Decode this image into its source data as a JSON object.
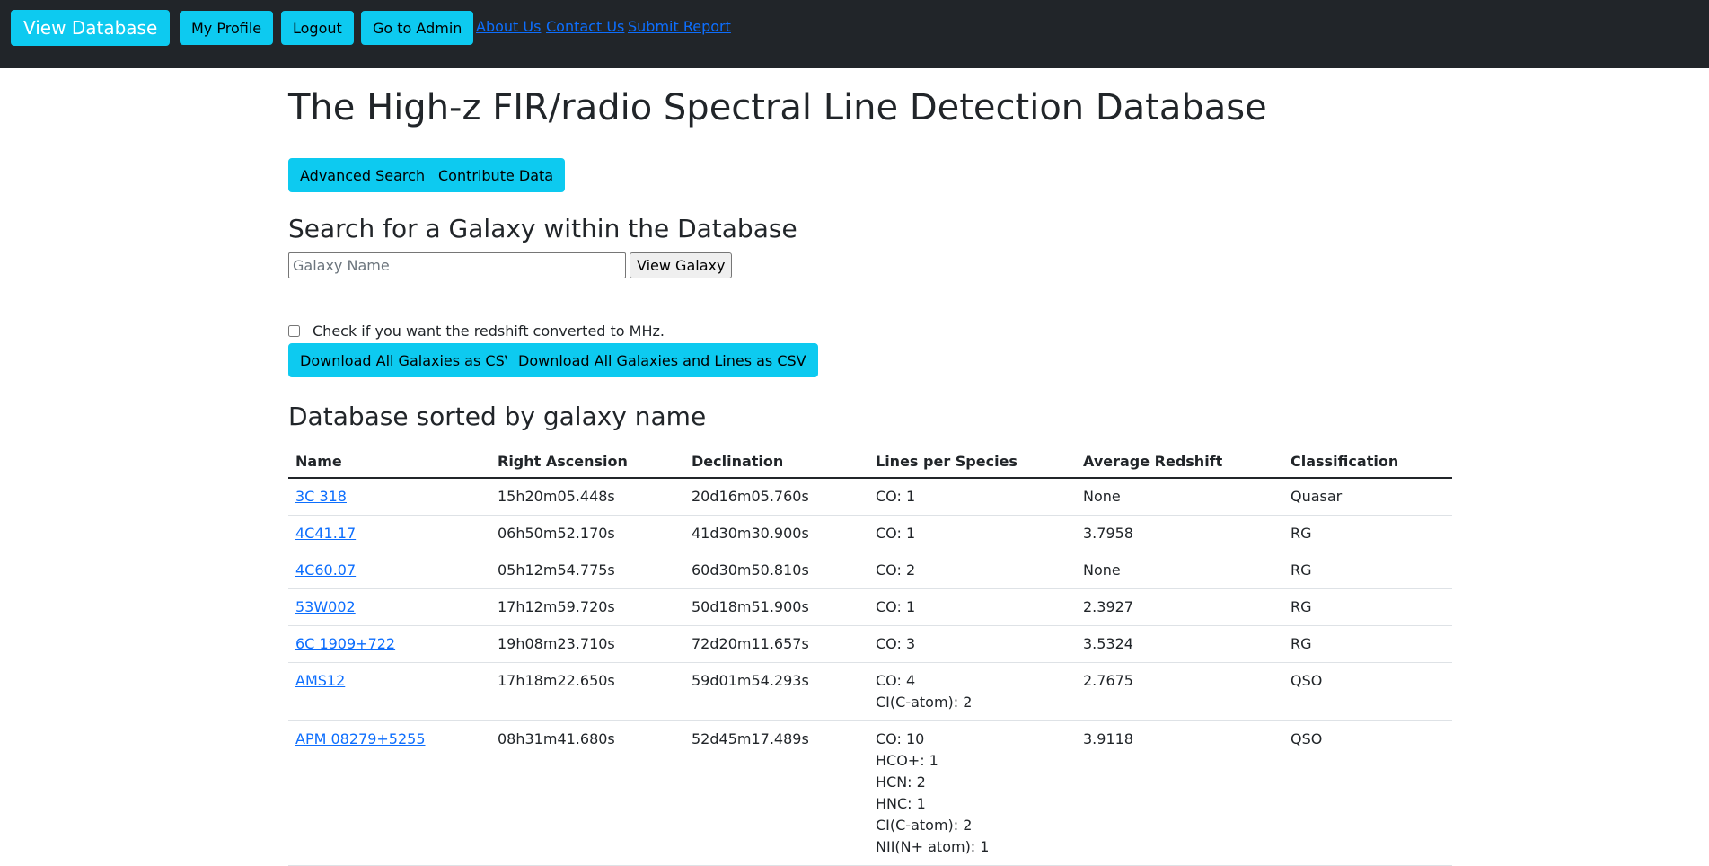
{
  "nav": {
    "brand": "View Database",
    "buttons": [
      "My Profile",
      "Logout",
      "Go to Admin"
    ],
    "links": [
      "About Us",
      "Contact Us",
      "Submit Report"
    ]
  },
  "page_title": "The High-z FIR/radio Spectral Line Detection Database",
  "actions": {
    "advanced_search": "Advanced Search",
    "contribute": "Contribute Data"
  },
  "search": {
    "heading": "Search for a Galaxy within the Database",
    "placeholder": "Galaxy Name",
    "value": "",
    "button": "View Galaxy"
  },
  "convert": {
    "label": "Check if you want the redshift converted to MHz.",
    "checked": false
  },
  "downloads": {
    "galaxies": "Download All Galaxies as CSV",
    "galaxies_lines": "Download All Galaxies and Lines as CSV"
  },
  "table": {
    "heading": "Database sorted by galaxy name",
    "columns": [
      "Name",
      "Right Ascension",
      "Declination",
      "Lines per Species",
      "Average Redshift",
      "Classification"
    ],
    "rows": [
      {
        "name": "3C 318",
        "ra": "15h20m05.448s",
        "dec": "20d16m05.760s",
        "lines": [
          "CO: 1"
        ],
        "z": "None",
        "cls": "Quasar"
      },
      {
        "name": "4C41.17",
        "ra": "06h50m52.170s",
        "dec": "41d30m30.900s",
        "lines": [
          "CO: 1"
        ],
        "z": "3.7958",
        "cls": "RG"
      },
      {
        "name": "4C60.07",
        "ra": "05h12m54.775s",
        "dec": "60d30m50.810s",
        "lines": [
          "CO: 2"
        ],
        "z": "None",
        "cls": "RG"
      },
      {
        "name": "53W002",
        "ra": "17h12m59.720s",
        "dec": "50d18m51.900s",
        "lines": [
          "CO: 1"
        ],
        "z": "2.3927",
        "cls": "RG"
      },
      {
        "name": "6C 1909+722",
        "ra": "19h08m23.710s",
        "dec": "72d20m11.657s",
        "lines": [
          "CO: 3"
        ],
        "z": "3.5324",
        "cls": "RG"
      },
      {
        "name": "AMS12",
        "ra": "17h18m22.650s",
        "dec": "59d01m54.293s",
        "lines": [
          "CO: 4",
          "CI(C-atom): 2"
        ],
        "z": "2.7675",
        "cls": "QSO"
      },
      {
        "name": "APM 08279+5255",
        "ra": "08h31m41.680s",
        "dec": "52d45m17.489s",
        "lines": [
          "CO: 10",
          "HCO+: 1",
          "HCN: 2",
          "HNC: 1",
          "CI(C-atom): 2",
          "NII(N+ atom): 1"
        ],
        "z": "3.9118",
        "cls": "QSO"
      }
    ]
  }
}
